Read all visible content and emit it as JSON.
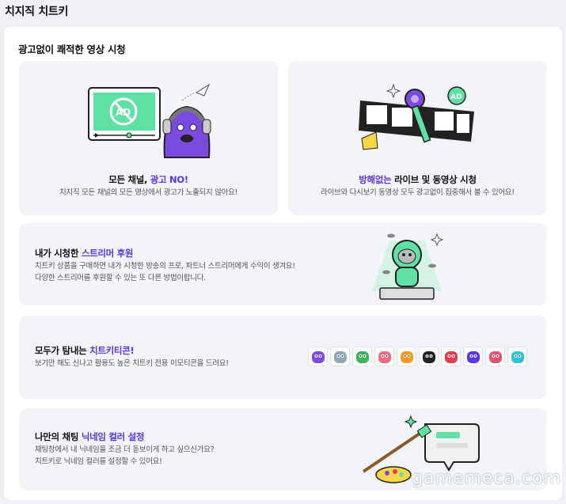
{
  "page_title": "치지직 치트키",
  "section_title": "광고없이 쾌적한 영상 시청",
  "cards": {
    "no_ads": {
      "title_pre": "모든 채널, ",
      "title_hl": "광고 NO!",
      "desc": "치지직 모든 채널의 모든 영상에서 광고가 노출되지 않아요!",
      "badge": "AD"
    },
    "uninterrupted": {
      "title_hl": "방해없는",
      "title_post": " 라이브 및 동영상 시청",
      "desc": "라이브와 다시보기 동영상 모두 광고없이 집중해서 볼 수 있어요!",
      "badge": "AD"
    },
    "sponsor": {
      "title_pre": "내가 시청한 ",
      "title_hl": "스트리머 후원",
      "desc_lines": [
        "치트키 상품을 구매하면 내가 시청한 방송의 프로, 파트너 스트리머에게 수익이 생겨요!",
        "다양한 스트리머를 후원할 수 있는 또 다른 방법이랍니다."
      ]
    },
    "emoticon": {
      "title_pre": "모두가 탐내는 ",
      "title_hl": "치트키티콘!",
      "desc": "보기만 해도 신나고 활용도 높은 치트키 전용 이모티콘을 드려요!"
    },
    "nickname": {
      "title_pre": "나만의 채팅 ",
      "title_hl": "닉네임 컬러 설정",
      "desc_lines": [
        "채팅창에서 내 닉네임을 조금 더 돋보이게 하고 싶으신가요?",
        "치트키로 닉네임 컬러를 설정할 수 있어요!"
      ]
    }
  },
  "emoticons": [
    {
      "icon": "purple-blob-emoticon",
      "color": "#7b4ae0"
    },
    {
      "icon": "alien-emoticon",
      "color": "#8fa8b8"
    },
    {
      "icon": "green-jester-emoticon",
      "color": "#3cb35a"
    },
    {
      "icon": "pink-face-emoticon",
      "color": "#f06a86"
    },
    {
      "icon": "fire-emoticon",
      "color": "#f39a1f"
    },
    {
      "icon": "grid-emoticon",
      "color": "#222222"
    },
    {
      "icon": "red-face-emoticon",
      "color": "#e53d4a"
    },
    {
      "icon": "purple-sleep-emoticon",
      "color": "#5b35e6"
    },
    {
      "icon": "pink-monster-emoticon",
      "color": "#e05670"
    },
    {
      "icon": "cyan-purple-emoticon",
      "color": "#2dc3d8"
    }
  ],
  "watermark": "gamemeca.com",
  "colors": {
    "accent": "#5b35e6",
    "mint": "#5fe0a4",
    "card_bg": "#f2f4f7"
  }
}
